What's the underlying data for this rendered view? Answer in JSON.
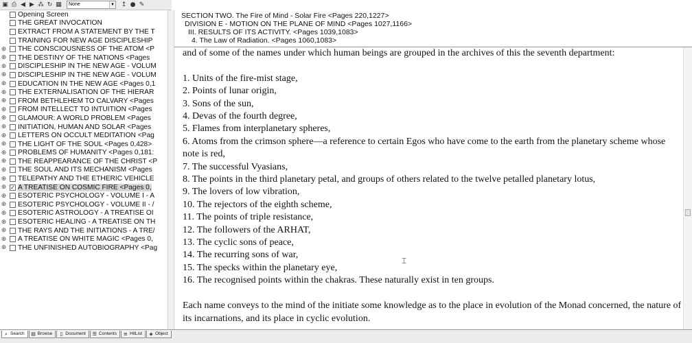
{
  "toolbar": {
    "search_dropdown_value": "None"
  },
  "tree": {
    "items": [
      {
        "label": "Opening Screen",
        "expandable": false,
        "checked": false
      },
      {
        "label": "THE GREAT INVOCATION",
        "expandable": false,
        "checked": false
      },
      {
        "label": "EXTRACT FROM A STATEMENT BY THE T",
        "expandable": false,
        "checked": false
      },
      {
        "label": "TRAINING FOR NEW AGE DISCIPLESHIP",
        "expandable": false,
        "checked": false
      },
      {
        "label": "THE CONSCIOUSNESS OF THE ATOM <P",
        "expandable": true,
        "checked": false
      },
      {
        "label": "THE DESTINY OF THE NATIONS <Pages",
        "expandable": true,
        "checked": false
      },
      {
        "label": "DISCIPLESHIP IN THE NEW AGE - VOLUM",
        "expandable": true,
        "checked": false
      },
      {
        "label": "DISCIPLESHIP IN THE NEW AGE - VOLUM",
        "expandable": true,
        "checked": false
      },
      {
        "label": "EDUCATION IN THE NEW AGE <Pages 0,1",
        "expandable": true,
        "checked": false
      },
      {
        "label": "THE EXTERNALISATION OF THE HIERAR",
        "expandable": true,
        "checked": false
      },
      {
        "label": "FROM BETHLEHEM TO CALVARY <Pages",
        "expandable": true,
        "checked": false
      },
      {
        "label": "FROM INTELLECT TO INTUITION <Pages",
        "expandable": true,
        "checked": false
      },
      {
        "label": "GLAMOUR: A WORLD PROBLEM <Pages",
        "expandable": true,
        "checked": false
      },
      {
        "label": "INITIATION, HUMAN AND SOLAR <Pages",
        "expandable": true,
        "checked": false
      },
      {
        "label": "LETTERS ON OCCULT MEDITATION <Pag",
        "expandable": true,
        "checked": false
      },
      {
        "label": "THE LIGHT OF THE SOUL <Pages 0,428>",
        "expandable": true,
        "checked": false
      },
      {
        "label": "PROBLEMS OF HUMANITY <Pages 0,181:",
        "expandable": true,
        "checked": false
      },
      {
        "label": "THE REAPPEARANCE OF THE CHRIST <P",
        "expandable": true,
        "checked": false
      },
      {
        "label": "THE SOUL AND ITS MECHANISM <Pages",
        "expandable": true,
        "checked": false
      },
      {
        "label": "TELEPATHY AND THE ETHERIC VEHICLE",
        "expandable": true,
        "checked": false
      },
      {
        "label": "A TREATISE ON COSMIC FIRE <Pages 0,",
        "expandable": true,
        "checked": true,
        "selected": true
      },
      {
        "label": "ESOTERIC PSYCHOLOGY - VOLUME I - A",
        "expandable": true,
        "checked": false
      },
      {
        "label": "ESOTERIC PSYCHOLOGY - VOLUME II - /",
        "expandable": true,
        "checked": false
      },
      {
        "label": "ESOTERIC ASTROLOGY - A TREATISE OI",
        "expandable": true,
        "checked": false
      },
      {
        "label": "ESOTERIC HEALING - A TREATISE ON TH",
        "expandable": true,
        "checked": false
      },
      {
        "label": "THE RAYS AND THE INITIATIONS - A TRE/",
        "expandable": true,
        "checked": false
      },
      {
        "label": "A TREATISE ON WHITE MAGIC <Pages 0,",
        "expandable": true,
        "checked": false
      },
      {
        "label": "THE UNFINISHED AUTOBIOGRAPHY <Pag",
        "expandable": true,
        "checked": false
      }
    ]
  },
  "header": {
    "section": "SECTION TWO.  The Fire of Mind - Solar Fire <Pages 220,1227>",
    "division": "DIVISION E - MOTION ON THE PLANE OF MIND <Pages 1027,1166>",
    "subsection": "III. RESULTS OF ITS ACTIVITY. <Pages 1039,1083>",
    "topic": "4. The Law of Radiation. <Pages 1060,1083>"
  },
  "document": {
    "intro": "and of some of the names under which human beings are grouped in the archives of this the seventh department:",
    "list": [
      "1. Units of the fire-mist stage,",
      "2. Points of lunar origin,",
      "3. Sons of the sun,",
      "4. Devas of the fourth degree,",
      "5. Flames from interplanetary spheres,",
      "6. Atoms from the crimson sphere—a reference to certain Egos who have come to the earth from the planetary scheme whose note is red,",
      "7. The successful Vyasians,",
      "8. The points in the third planetary petal, and groups of others related to the twelve petalled planetary lotus,",
      "9. The lovers of low vibration,",
      "10. The rejectors of the eighth scheme,",
      "11. The points of triple resistance,",
      "12. The followers of the ARHAT,",
      "13. The cyclic sons of peace,",
      "14. The recurring sons of war,",
      "15. The specks within the planetary eye,",
      "16. The recognised points within the chakras.  These naturally exist in ten groups."
    ],
    "closing": "Each name conveys to the mind of the initiate some knowledge as to the place in evolution of the Monad concerned, the nature of its incarnations, and its place in cyclic evolution."
  },
  "tabs": [
    {
      "label": "Search",
      "icon": "search-icon",
      "active": true
    },
    {
      "label": "Browse",
      "icon": "browse-icon",
      "active": false
    },
    {
      "label": "Document",
      "icon": "document-icon",
      "active": false
    },
    {
      "label": "Contents",
      "icon": "contents-icon",
      "active": false
    },
    {
      "label": "HitList",
      "icon": "hitlist-icon",
      "active": false
    },
    {
      "label": "Object",
      "icon": "object-icon",
      "active": false
    }
  ]
}
